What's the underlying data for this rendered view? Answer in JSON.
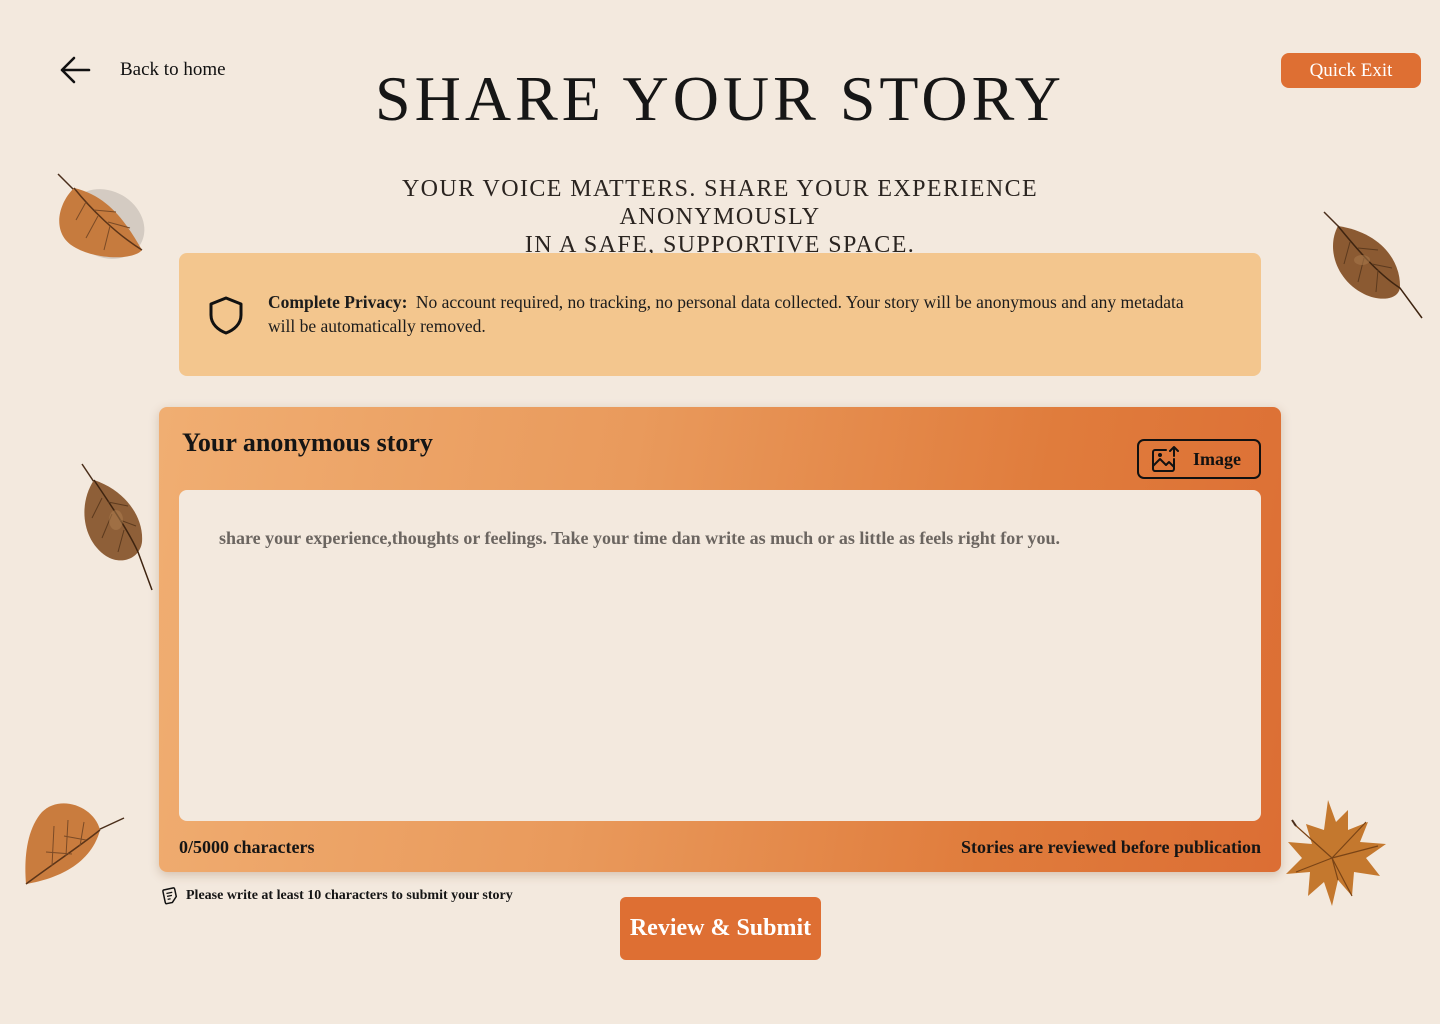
{
  "header": {
    "back_label": "Back to home",
    "quick_exit_label": "Quick Exit",
    "title": "SHARE YOUR STORY",
    "subtitle_line1": "YOUR VOICE MATTERS. SHARE YOUR EXPERIENCE ANONYMOUSLY",
    "subtitle_line2": "IN A SAFE, SUPPORTIVE SPACE."
  },
  "privacy": {
    "heading": "Complete Privacy:",
    "body": "No account required, no tracking, no personal data collected. Your story will be anonymous and any metadata will be automatically removed.",
    "icon": "shield-icon"
  },
  "story": {
    "title": "Your anonymous story",
    "image_button_label": "Image",
    "image_button_icon": "image-upload-icon",
    "placeholder": "share your experience,thoughts or feelings. Take your time dan write as much or as little as feels right for you.",
    "value": "",
    "char_count": "0/5000 characters",
    "review_note": "Stories are reviewed before publication"
  },
  "hint": {
    "text": "Please write at least 10 characters to submit your story",
    "icon": "note-icon"
  },
  "submit": {
    "label": "Review & Submit"
  },
  "colors": {
    "background": "#f3e9de",
    "accent": "#de6f33",
    "privacy_box": "#f3c68e",
    "card_gradient_start": "#f0ae72",
    "card_gradient_end": "#dc6e34"
  }
}
